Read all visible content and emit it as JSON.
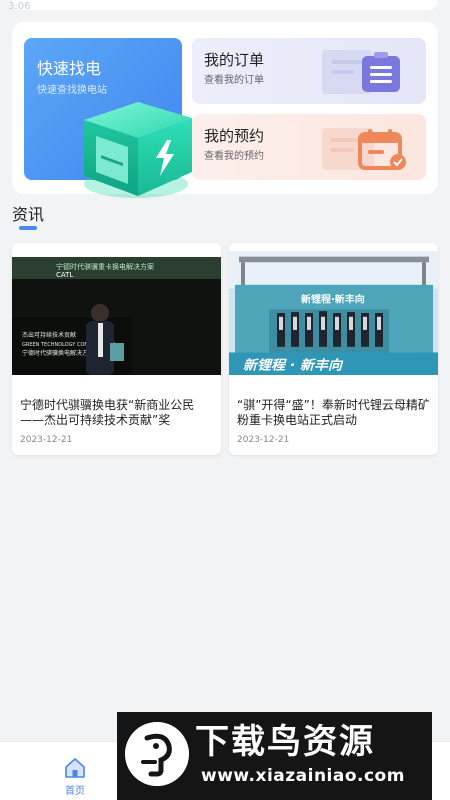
{
  "status_bar": {
    "fragment": "3:06"
  },
  "services": {
    "find": {
      "title": "快速找电",
      "subtitle": "快速查找换电站"
    },
    "orders": {
      "title": "我的订单",
      "subtitle": "查看我的订单"
    },
    "appointments": {
      "title": "我的预约",
      "subtitle": "查看我的预约"
    }
  },
  "news": {
    "heading": "资讯",
    "items": [
      {
        "title": "宁德时代骐骥换电获“新商业公民——杰出可持续技术贡献”奖",
        "date": "2023-12-21",
        "image_text": {
          "banner": "宁德时代骐骥重卡换电解决方案",
          "brand": "CATL",
          "lines": [
            "杰出可持续技术贡献",
            "GREEN TECHNOLOGY CONTRIBUTION",
            "宁德时代骐骥换电解决方案"
          ]
        }
      },
      {
        "title": "“骐”开得“盛”！奉新时代锂云母精矿粉重卡换电站正式启动",
        "date": "2023-12-21",
        "image_text": {
          "banner": "新锂程·新丰向",
          "slogan": "新锂程 · 新丰向"
        }
      }
    ]
  },
  "tabbar": {
    "home_label": "首页"
  },
  "watermark": {
    "title": "下载鸟资源",
    "url": "www.xiazainiao.com"
  },
  "colors": {
    "accent": "#4b86f0",
    "find_card": "#4a92f2",
    "order_icon": "#6f6fd8",
    "appt_icon": "#f0875a"
  },
  "icons": {
    "battery_box": "battery-box-icon",
    "orders": "clipboard-icon",
    "appointments": "calendar-icon",
    "home": "home-icon"
  }
}
